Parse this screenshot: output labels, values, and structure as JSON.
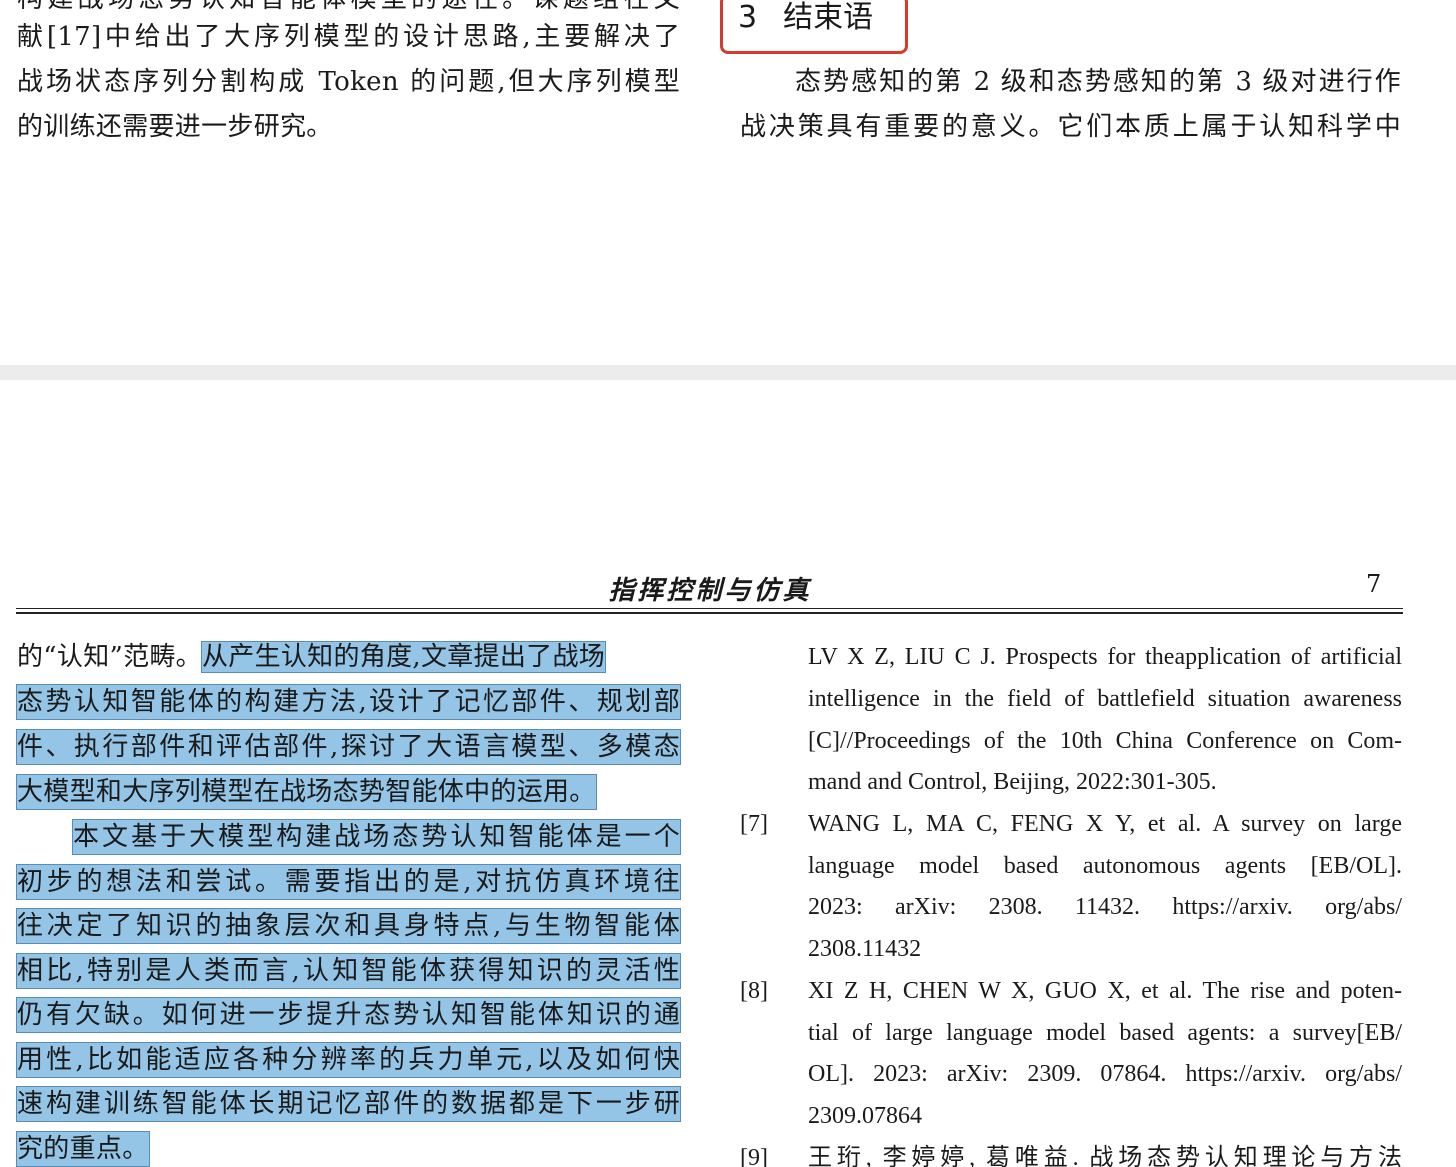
{
  "top_page": {
    "left_column": {
      "cut_line": "构建战场态势认知智能体模型的途径。课题组在文",
      "lines": [
        "献[17]中给出了大序列模型的设计思路,主要解决了",
        "战场状态序列分割构成 Token 的问题,但大序列模型",
        "的训练还需要进一步研究。"
      ]
    },
    "right_column": {
      "heading_number": "3",
      "heading_title": "结束语",
      "lines": [
        "态势感知的第 2 级和态势感知的第 3 级对进行作",
        "战决策具有重要的意义。它们本质上属于认知科学中"
      ]
    }
  },
  "bottom_page": {
    "journal_title": "指挥控制与仿真",
    "page_number": "7",
    "left_column": {
      "line_1_plain": "的“认知”范畴。",
      "line_1_highlight": "从产生认知的角度,文章提出了战场",
      "highlighted_lines": [
        "态势认知智能体的构建方法,设计了记忆部件、规划部",
        "件、执行部件和评估部件,探讨了大语言模型、多模态",
        "大模型和大序列模型在战场态势智能体中的运用。"
      ],
      "para2_first": "本文基于大模型构建战场态势认知智能体是一个",
      "para2_lines": [
        "初步的想法和尝试。需要指出的是,对抗仿真环境往",
        "往决定了知识的抽象层次和具身特点,与生物智能体",
        "相比,特别是人类而言,认知智能体获得知识的灵活性",
        "仍有欠缺。如何进一步提升态势认知智能体知识的通",
        "用性,比如能适应各种分辨率的兵力单元,以及如何快",
        "速构建训练智能体长期记忆部件的数据都是下一步研"
      ],
      "para2_last": "究的重点。"
    },
    "right_column": {
      "ref6_lines": [
        "LV X Z, LIU C J. Prospects for theapplication of artificial",
        "intelligence in the field of battlefield situation awareness",
        "[C]//Proceedings of the 10th China Conference on Com-",
        "mand and Control, Beijing, 2022:301-305."
      ],
      "ref7_num": "[7]",
      "ref7_lines": [
        "WANG L, MA C, FENG X Y, et al. A survey on large",
        "language model based autonomous agents [EB/OL].",
        "2023: arXiv: 2308. 11432. https://arxiv. org/abs/",
        "2308.11432"
      ],
      "ref8_num": "[8]",
      "ref8_lines": [
        "XI Z H, CHEN W X, GUO X, et al. The rise and poten-",
        "tial of large language model based agents: a survey[EB/",
        "OL]. 2023: arXiv: 2309. 07864. https://arxiv. org/abs/",
        "2309.07864"
      ],
      "ref9_num": "[9]",
      "ref9_cut": "王珩, 李婷婷, 葛唯益. 战场态势认知理论与方法"
    }
  }
}
